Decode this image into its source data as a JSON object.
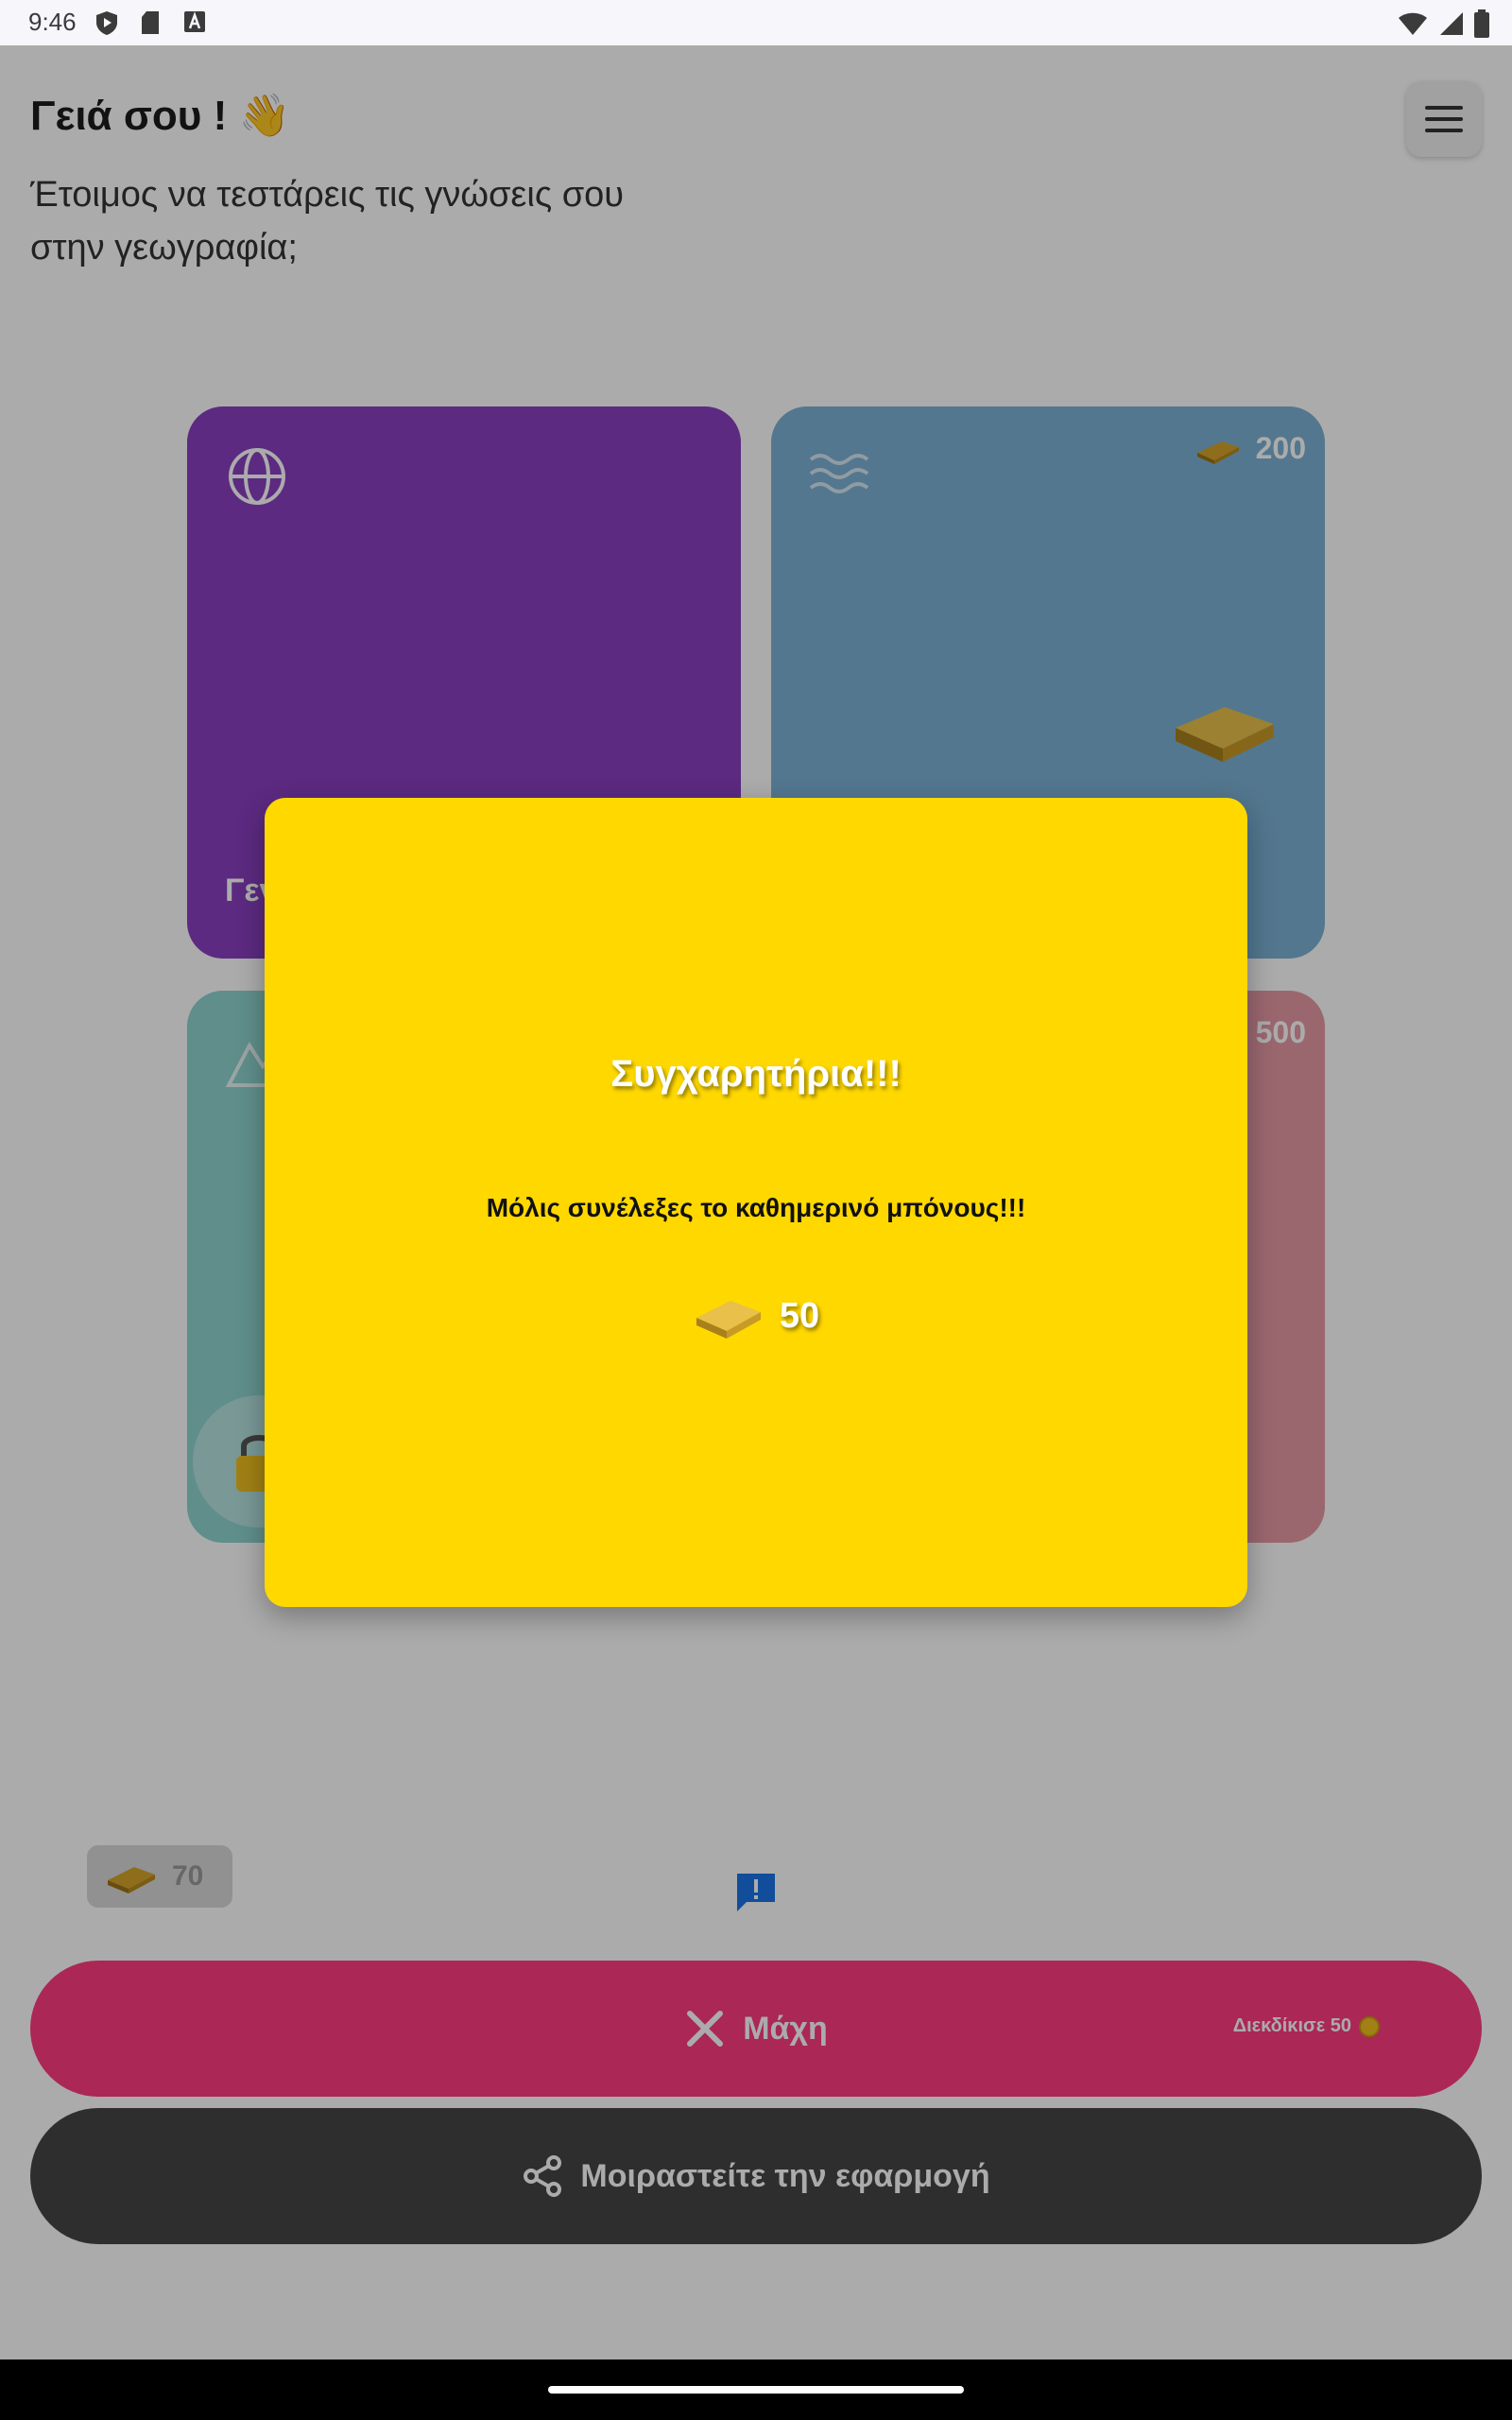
{
  "status_bar": {
    "time": "9:46",
    "icons": [
      "shield-play-icon",
      "sd-card-icon",
      "font-a-icon",
      "wifi-icon",
      "signal-icon",
      "battery-icon"
    ]
  },
  "header": {
    "greeting": "Γειά σου ! 👋",
    "subtitle": "Έτοιμος να τεστάρεις τις γνώσεις σου στην γεωγραφία;",
    "menu_icon": "hamburger-menu-icon"
  },
  "cards": [
    {
      "id": "general",
      "icon": "globe-icon",
      "label_visible": "Γεν",
      "color": "#8a3fc0"
    },
    {
      "id": "seas",
      "icon": "waves-icon",
      "price": "200",
      "color": "#7db2d6"
    },
    {
      "id": "mountains",
      "icon": "mountain-icon",
      "locked": true,
      "color": "#8ed4cf"
    },
    {
      "id": "fourth",
      "price": "500",
      "color": "#e79aa6"
    }
  ],
  "wallet": {
    "coins": "70"
  },
  "battle": {
    "label": "Μάχη",
    "claim": "Διεκδίκισε 50"
  },
  "share": {
    "label": "Μοιραστείτε την εφαρμογή"
  },
  "modal": {
    "title": "Συγχαρητήρια!!!",
    "message": "Μόλις συνέλεξες το καθημερινό μπόνους!!!",
    "reward": "50"
  },
  "colors": {
    "modal_bg": "#ffd800",
    "battle_btn": "#ff3b7f",
    "share_btn": "#454545",
    "scrim": "rgba(0,0,0,0.33)"
  }
}
